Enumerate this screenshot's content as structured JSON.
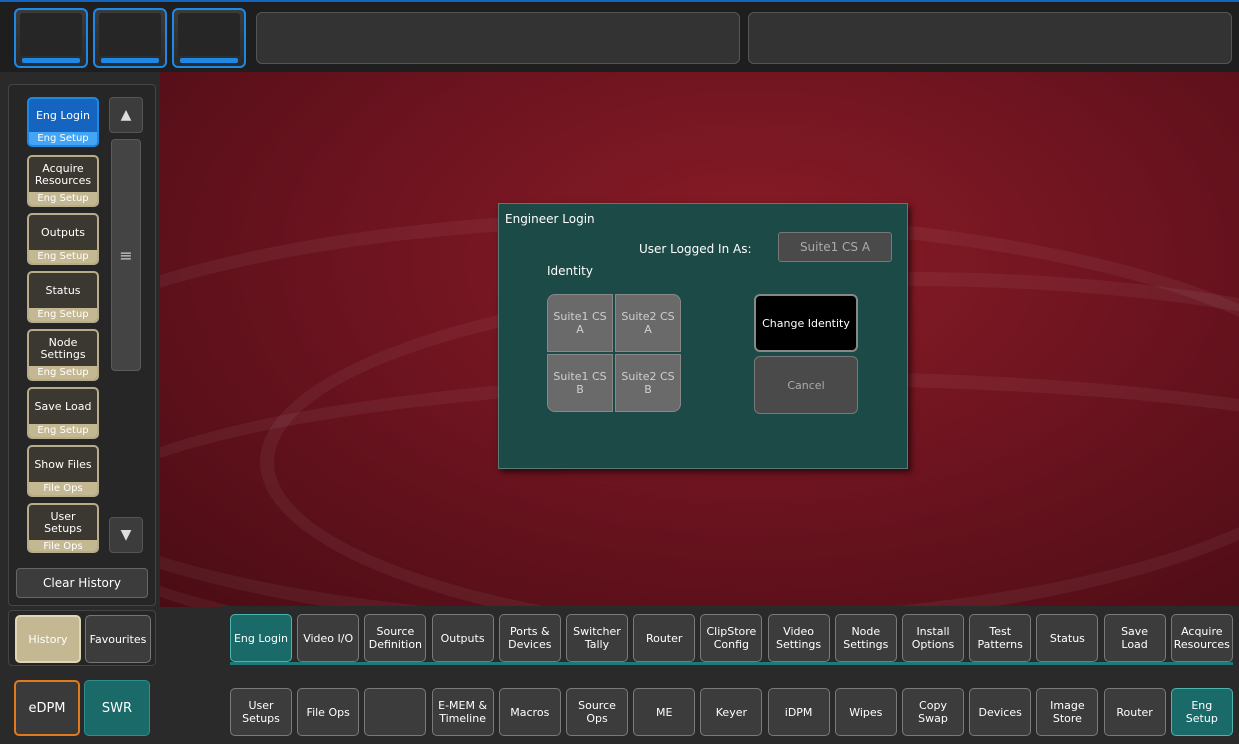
{
  "dialog": {
    "title": "Engineer Login",
    "logged_in_label": "User Logged In As:",
    "logged_in_value": "Suite1  CS A",
    "identity_label": "Identity",
    "identities": [
      "Suite1 CS A",
      "Suite2 CS A",
      "Suite1 CS B",
      "Suite2 CS B"
    ],
    "change_identity_label": "Change Identity",
    "cancel_label": "Cancel"
  },
  "sidebar": {
    "items": [
      {
        "label": "Eng Login",
        "sub": "Eng Setup",
        "active": true
      },
      {
        "label": "Acquire Resources",
        "sub": "Eng Setup",
        "active": false
      },
      {
        "label": "Outputs",
        "sub": "Eng Setup",
        "active": false
      },
      {
        "label": "Status",
        "sub": "Eng Setup",
        "active": false
      },
      {
        "label": "Node Settings",
        "sub": "Eng Setup",
        "active": false
      },
      {
        "label": "Save Load",
        "sub": "Eng Setup",
        "active": false
      },
      {
        "label": "Show Files",
        "sub": "File Ops",
        "active": false
      },
      {
        "label": "User Setups",
        "sub": "File Ops",
        "active": false
      }
    ],
    "clear_history_label": "Clear History",
    "history_label": "History",
    "favourites_label": "Favourites"
  },
  "modes": {
    "edpm_label": "eDPM",
    "swr_label": "SWR"
  },
  "tabs_row1": [
    {
      "label": "Eng Login",
      "active": true
    },
    {
      "label": "Video I/O",
      "active": false
    },
    {
      "label": "Source Definition",
      "active": false
    },
    {
      "label": "Outputs",
      "active": false
    },
    {
      "label": "Ports & Devices",
      "active": false
    },
    {
      "label": "Switcher Tally",
      "active": false
    },
    {
      "label": "Router",
      "active": false
    },
    {
      "label": "ClipStore Config",
      "active": false
    },
    {
      "label": "Video Settings",
      "active": false
    },
    {
      "label": "Node Settings",
      "active": false
    },
    {
      "label": "Install Options",
      "active": false
    },
    {
      "label": "Test Patterns",
      "active": false
    },
    {
      "label": "Status",
      "active": false
    },
    {
      "label": "Save Load",
      "active": false
    },
    {
      "label": "Acquire Resources",
      "active": false
    }
  ],
  "tabs_row2": [
    {
      "label": "User Setups",
      "active": false
    },
    {
      "label": "File Ops",
      "active": false
    },
    {
      "label": "",
      "active": false
    },
    {
      "label": "E-MEM & Timeline",
      "active": false
    },
    {
      "label": "Macros",
      "active": false
    },
    {
      "label": "Source Ops",
      "active": false
    },
    {
      "label": "ME",
      "active": false
    },
    {
      "label": "Keyer",
      "active": false
    },
    {
      "label": "iDPM",
      "active": false
    },
    {
      "label": "Wipes",
      "active": false
    },
    {
      "label": "Copy Swap",
      "active": false
    },
    {
      "label": "Devices",
      "active": false
    },
    {
      "label": "Image Store",
      "active": false
    },
    {
      "label": "Router",
      "active": false
    },
    {
      "label": "Eng Setup",
      "active": true
    }
  ],
  "icons": {
    "scroll_up": "triangle-up-icon",
    "scroll_down": "triangle-down-icon",
    "scroll_thumb": "hamburger-icon"
  },
  "colors": {
    "accent_blue": "#1e88e5",
    "teal_active": "#1a6a6a",
    "background_red": "#6e1420",
    "dialog_bg": "#1c4a47",
    "history_tan": "#c3b892",
    "edpm_orange": "#e07a1c"
  }
}
